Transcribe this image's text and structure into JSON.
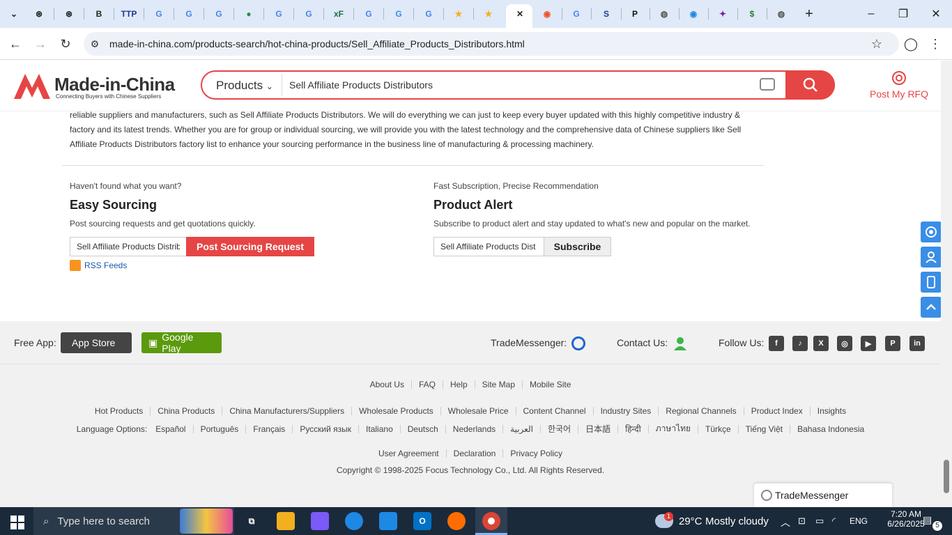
{
  "browser": {
    "tabs": [
      {
        "icon": "openai-icon",
        "glyph": "⊛",
        "color": "#222"
      },
      {
        "icon": "openai-icon",
        "glyph": "⊛",
        "color": "#222"
      },
      {
        "icon": "bold-b-icon",
        "glyph": "B",
        "color": "#222"
      },
      {
        "icon": "ttp-icon",
        "glyph": "TTP",
        "color": "#1f3a93"
      },
      {
        "icon": "google-icon",
        "glyph": "G",
        "color": "#4285f4"
      },
      {
        "icon": "google-icon",
        "glyph": "G",
        "color": "#4285f4"
      },
      {
        "icon": "google-icon",
        "glyph": "G",
        "color": "#4285f4"
      },
      {
        "icon": "globe-green-icon",
        "glyph": "●",
        "color": "#2e8b57"
      },
      {
        "icon": "google-icon",
        "glyph": "G",
        "color": "#4285f4"
      },
      {
        "icon": "google-icon",
        "glyph": "G",
        "color": "#4285f4"
      },
      {
        "icon": "excel-icon",
        "glyph": "xF",
        "color": "#1d6f42"
      },
      {
        "icon": "google-icon",
        "glyph": "G",
        "color": "#4285f4"
      },
      {
        "icon": "google-icon",
        "glyph": "G",
        "color": "#4285f4"
      },
      {
        "icon": "google-icon",
        "glyph": "G",
        "color": "#4285f4"
      },
      {
        "icon": "star-icon",
        "glyph": "★",
        "color": "#f2b01e"
      },
      {
        "icon": "star-icon",
        "glyph": "★",
        "color": "#f2b01e"
      },
      {
        "icon": "close-icon",
        "glyph": "✕",
        "color": "#222"
      },
      {
        "icon": "orange-app-icon",
        "glyph": "◉",
        "color": "#f25022"
      },
      {
        "icon": "google-icon",
        "glyph": "G",
        "color": "#4285f4"
      },
      {
        "icon": "s-logo-icon",
        "glyph": "S",
        "color": "#1f3a93"
      },
      {
        "icon": "paypal-icon",
        "glyph": "P",
        "color": "#111"
      },
      {
        "icon": "globe-icon",
        "glyph": "◍",
        "color": "#555"
      },
      {
        "icon": "blue-app-icon",
        "glyph": "◉",
        "color": "#1e88e5"
      },
      {
        "icon": "puzzle-icon",
        "glyph": "✦",
        "color": "#7b1fa2"
      },
      {
        "icon": "dollar-icon",
        "glyph": "$",
        "color": "#2e7d32"
      },
      {
        "icon": "globe-icon",
        "glyph": "◍",
        "color": "#555"
      }
    ],
    "new_tab": "+",
    "url": "made-in-china.com/products-search/hot-china-products/Sell_Affiliate_Products_Distributors.html"
  },
  "header": {
    "logo_text": "Made-in-China",
    "logo_sub": "Connecting Buyers with Chinese Suppliers",
    "search_category": "Products",
    "search_value": "Sell Affiliate Products Distributors",
    "rfq_label": "Post My RFQ"
  },
  "main": {
    "description": "reliable suppliers and manufacturers, such as Sell Affiliate Products Distributors. We will do everything we can just to keep every buyer updated with this highly competitive industry & factory and its latest trends. Whether you are for group or individual sourcing, we will provide you with the latest technology and the comprehensive data of Chinese suppliers like Sell Affiliate Products Distributors factory list to enhance your sourcing performance in the business line of manufacturing & processing machinery.",
    "easy_sourcing": {
      "kicker": "Haven't found what you want?",
      "title": "Easy Sourcing",
      "desc": "Post sourcing requests and get quotations quickly.",
      "input_value": "Sell Affiliate Products Distrib",
      "button": "Post Sourcing Request",
      "rss": "RSS Feeds"
    },
    "product_alert": {
      "kicker": "Fast Subscription, Precise Recommendation",
      "title": "Product Alert",
      "desc": "Subscribe to product alert and stay updated to what's new and popular on the market.",
      "input_value": "Sell Affiliate Products Dist",
      "button": "Subscribe"
    }
  },
  "footer": {
    "free_app": "Free App:",
    "app_store": "App Store",
    "google_play": "Google Play",
    "trade_messenger": "TradeMessenger:",
    "contact": "Contact Us:",
    "follow": "Follow Us:",
    "social": [
      {
        "icon": "facebook-icon",
        "glyph": "f"
      },
      {
        "icon": "tiktok-icon",
        "glyph": "♪"
      },
      {
        "icon": "x-icon",
        "glyph": "X"
      },
      {
        "icon": "instagram-icon",
        "glyph": "◎"
      },
      {
        "icon": "youtube-icon",
        "glyph": "▶"
      },
      {
        "icon": "pinterest-icon",
        "glyph": "P"
      },
      {
        "icon": "linkedin-icon",
        "glyph": "in"
      }
    ],
    "links1": [
      "About Us",
      "FAQ",
      "Help",
      "Site Map",
      "Mobile Site"
    ],
    "links2": [
      "Hot Products",
      "China Products",
      "China Manufacturers/Suppliers",
      "Wholesale Products",
      "Wholesale Price",
      "Content Channel",
      "Industry Sites",
      "Regional Channels",
      "Product Index",
      "Insights"
    ],
    "language_label": "Language Options:",
    "languages": [
      "Español",
      "Português",
      "Français",
      "Русский язык",
      "Italiano",
      "Deutsch",
      "Nederlands",
      "العربية",
      "한국어",
      "日本語",
      "हिन्दी",
      "ภาษาไทย",
      "Türkçe",
      "Tiếng Việt",
      "Bahasa Indonesia"
    ],
    "links3": [
      "User Agreement",
      "Declaration",
      "Privacy Policy"
    ],
    "copyright": "Copyright © 1998-2025 Focus Technology Co., Ltd. All Rights Reserved."
  },
  "trademessenger_popup": "TradeMessenger",
  "taskbar": {
    "search_placeholder": "Type here to search",
    "weather_temp": "29°C",
    "weather_text": "Mostly cloudy",
    "weather_badge": "1",
    "language": "ENG",
    "time": "7:20 AM",
    "date": "6/26/2025",
    "notifications": "5"
  },
  "colors": {
    "brand": "#e64545",
    "accent": "#3a8ee6",
    "footer_bg": "#f1f1f1"
  }
}
